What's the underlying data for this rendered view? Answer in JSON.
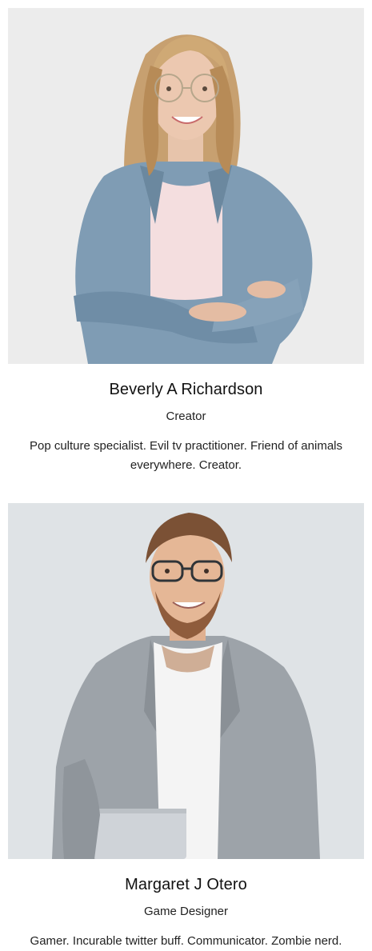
{
  "team": {
    "members": [
      {
        "name": "Beverly A Richardson",
        "role": "Creator",
        "bio": "Pop culture specialist. Evil tv practitioner. Friend of animals everywhere. Creator."
      },
      {
        "name": "Margaret J Otero",
        "role": "Game Designer",
        "bio": "Gamer. Incurable twitter buff. Communicator. Zombie nerd."
      }
    ]
  },
  "colors": {
    "photo_background_1": "#ececec",
    "photo_background_2": "#dfe3e6",
    "denim": "#7f9cb4",
    "blazer": "#9da3a9",
    "text": "#111111"
  }
}
